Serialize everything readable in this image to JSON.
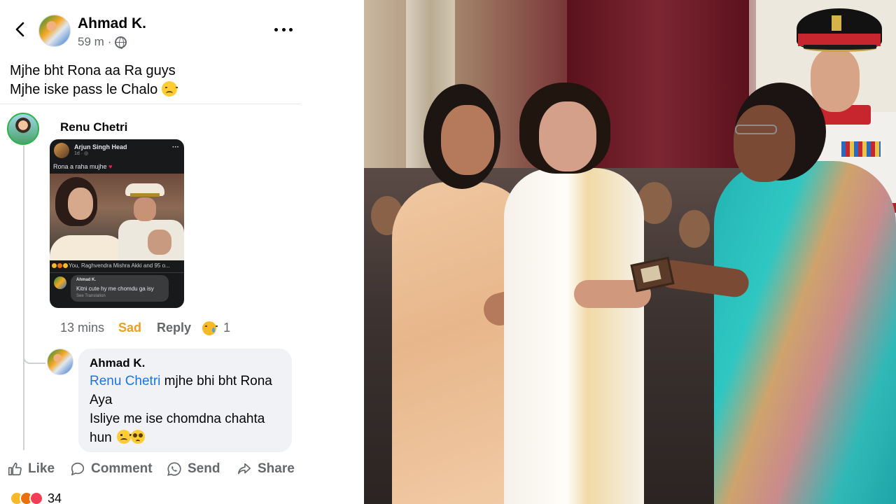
{
  "post": {
    "author": "Ahmad K.",
    "time": "59 m",
    "separator": "·",
    "privacy_icon": "globe-icon",
    "text_line1": "Mjhe bht Rona aa Ra guys",
    "text_line2": "Mjhe iske pass le Chalo"
  },
  "comment": {
    "author": "Renu Chetri",
    "time": "13 mins",
    "reaction_label": "Sad",
    "reply_label": "Reply",
    "reaction_count": "1",
    "screenshot": {
      "author": "Arjun Singh Head",
      "meta": "1d · ",
      "text": "Rona a raha mujhe ",
      "reactions": "You, Raghvendra Mishra Akki and 95 o...",
      "reply_author": "Ahmad K.",
      "reply_text": "Kitni cute hy me chomdu ga isy",
      "reply_translate": "See Translation"
    }
  },
  "reply": {
    "author": "Ahmad K.",
    "mention": "Renu Chetri",
    "text_part1": " mjhe bhi bht Rona Aya",
    "text_part2": "Isliye me ise chomdna chahta hun"
  },
  "actions": {
    "like": "Like",
    "comment": "Comment",
    "send": "Send",
    "share": "Share"
  },
  "reactions_summary": {
    "count": "34"
  },
  "colors": {
    "accent": "#1b74e4",
    "muted": "#65676b",
    "sad_reaction": "#e5a126"
  }
}
